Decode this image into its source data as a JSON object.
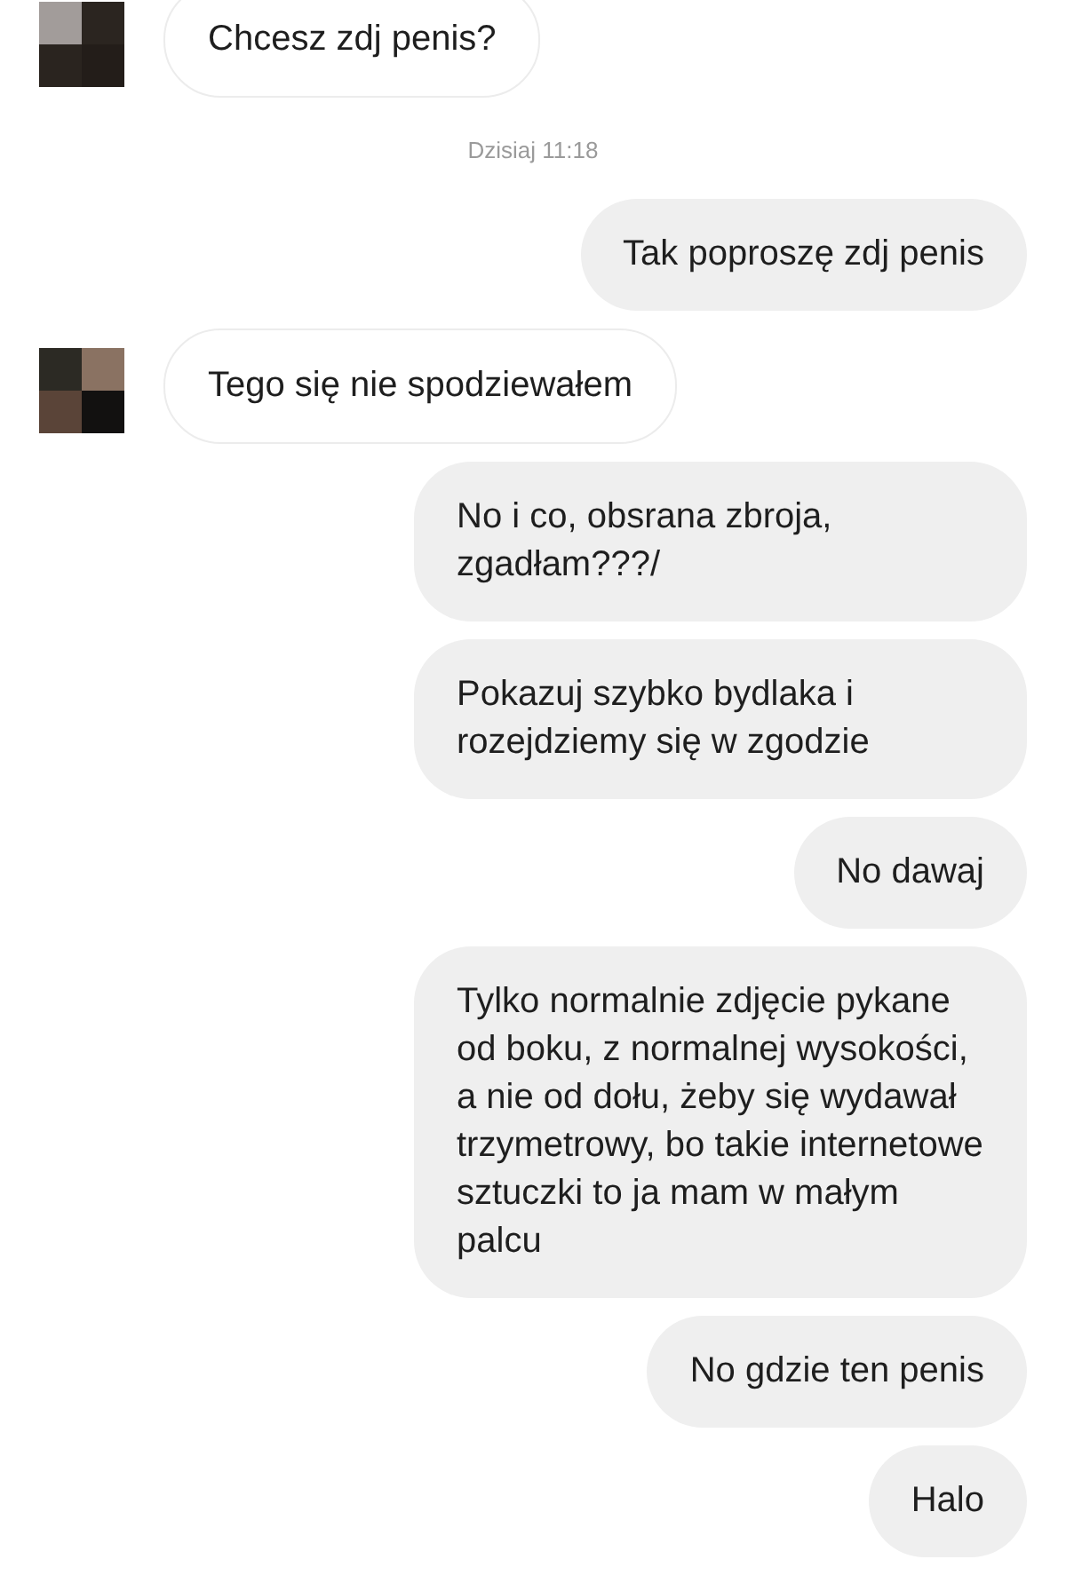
{
  "messages": [
    {
      "kind": "incoming",
      "avatar": true,
      "text": "Chcesz zdj penis?"
    },
    {
      "kind": "timestamp",
      "text": "Dzisiaj 11:18"
    },
    {
      "kind": "outgoing",
      "text": "Tak poproszę zdj penis"
    },
    {
      "kind": "incoming",
      "avatar": true,
      "text": "Tego się nie spodziewałem"
    },
    {
      "kind": "outgoing",
      "text": "No i co, obsrana zbroja, zgadłam???/"
    },
    {
      "kind": "outgoing",
      "text": "Pokazuj szybko bydlaka i rozejdziemy się w zgodzie"
    },
    {
      "kind": "outgoing",
      "text": "No dawaj"
    },
    {
      "kind": "outgoing",
      "text": "Tylko normalnie zdjęcie pykane od boku, z normalnej wysokości, a nie od dołu, żeby się wydawał trzymetrowy, bo takie internetowe sztuczki to ja mam w małym palcu"
    },
    {
      "kind": "outgoing",
      "text": "No gdzie ten penis"
    },
    {
      "kind": "outgoing",
      "text": "Halo"
    }
  ]
}
